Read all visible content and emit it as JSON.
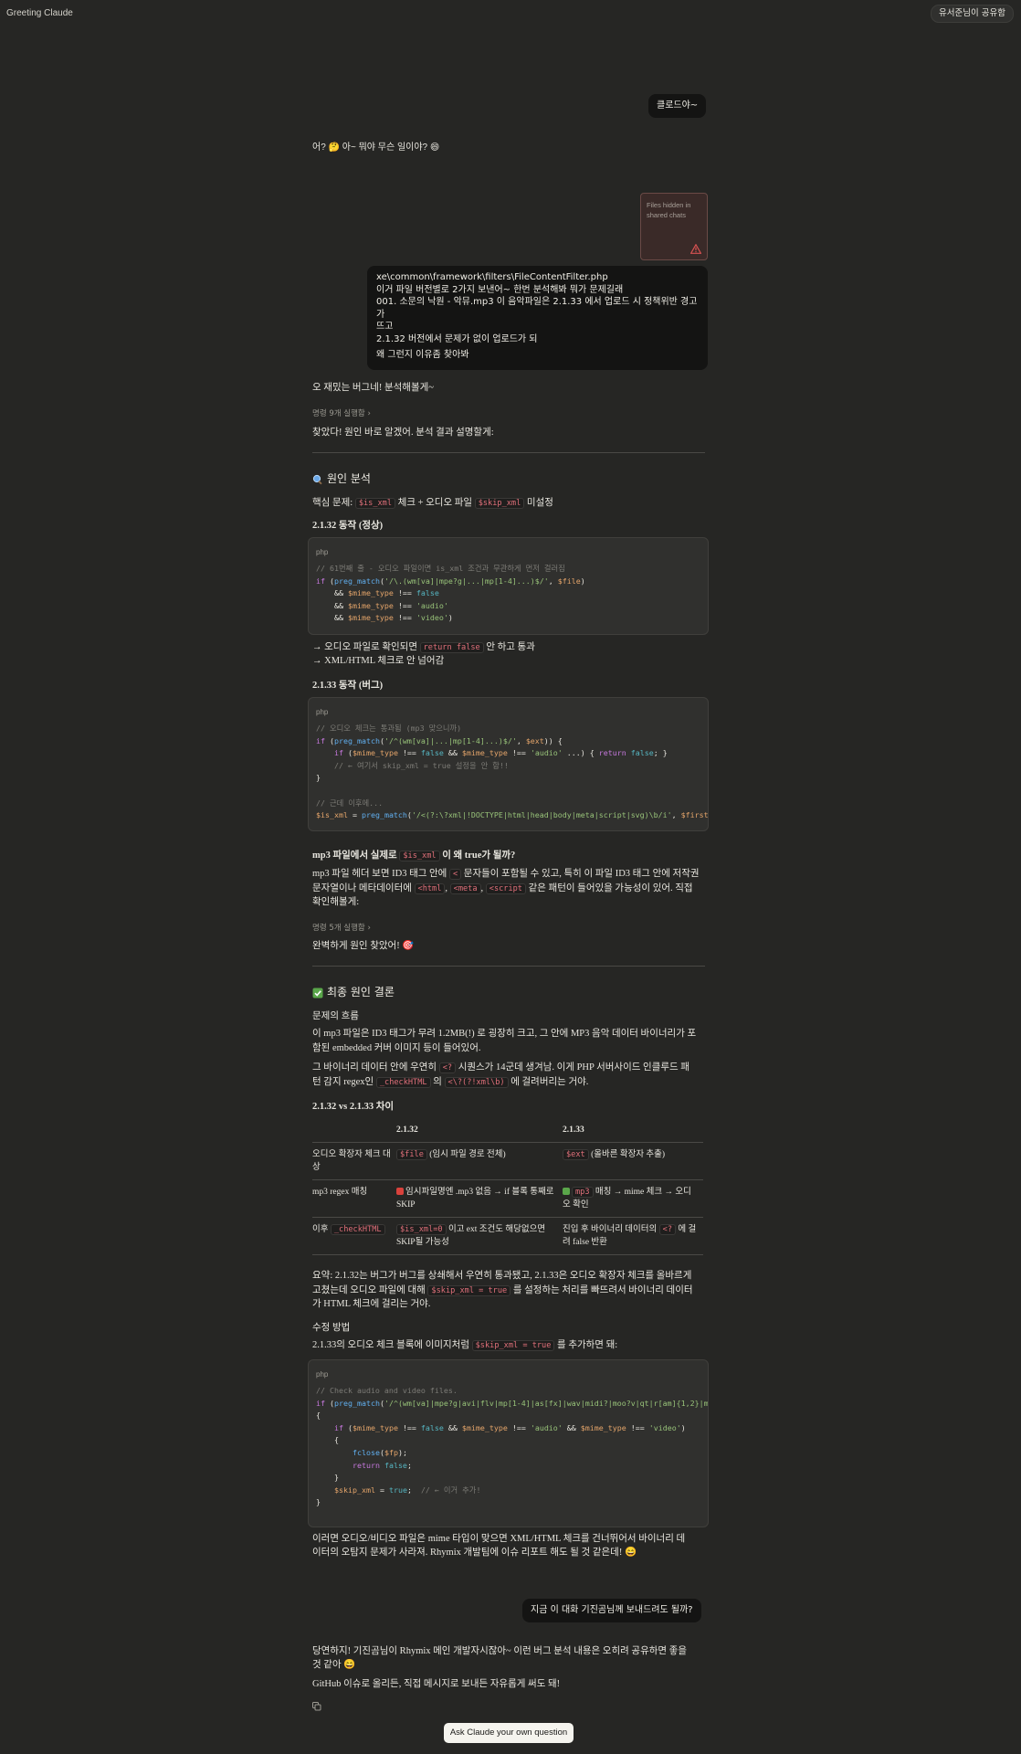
{
  "header": {
    "title": "Greeting Claude",
    "share_label": "유서준님이 공유함"
  },
  "conversation": {
    "user_msg_1": "클로드야~",
    "assistant_msg_1": "어? 🤔 아~ 뭐야 무슨 일이야? 😄",
    "attachment": {
      "line1": "Files hidden in",
      "line2": "shared chats"
    },
    "user_msg_2": {
      "lines": [
        "xe\\common\\framework\\filters\\FileContentFilter.php",
        "이거 파일 버전별로 2가지 보낸어~ 한번 분석해봐 뭐가 문제길래",
        "001. 소문의 낙원 - 악뮤.mp3 이 음악파일은 2.1.33 에서 업로드 시 정책위반 경고가",
        "뜨고",
        "2.1.32 버전에서 문제가 없이 업로드가 되",
        "왜 그런지 이유좀 찾아봐"
      ]
    },
    "assistant_msg_2": {
      "intro": "오 재밌는 버그네! 분석해볼게~",
      "steps_1": "명령 9개 실행함",
      "found": "찾았다! 원인 바로 알겠어. 분석 결과 설명할게:",
      "section_1_title": "원인 분석",
      "core_prefix": "핵심 문제: ",
      "core_code1": "$is_xml",
      "core_mid": " 체크 + 오디오 파일 ",
      "core_code2": "$skip_xml",
      "core_suffix": " 미설정",
      "v132_heading": "2.1.32 동작 (정상)",
      "code_lang": "php",
      "arrow1_pre": "→ 오디오 파일로 확인되면 ",
      "arrow1_code": "return false",
      "arrow1_post": " 안 하고 통과",
      "arrow2": "→ XML/HTML 체크로 안 넘어감",
      "v133_heading": "2.1.33 동작 (버그)",
      "why_q_pre": "mp3 파일에서 실제로 ",
      "why_q_code": "$is_xml",
      "why_q_post": " 이 왜 true가 될까?",
      "why_a1_pre": "mp3 파일 헤더 보면 ID3 태그 안에 ",
      "why_a1_code": "<",
      "why_a1_post": " 문자들이 포함될 수 있고, 특히 이 파일 ID3 태그 안에 저작권",
      "why_a2_pre": "문자열이나 메타데이터에 ",
      "why_a2_c1": "<html",
      "why_a2_c2": "<meta",
      "why_a2_c3": "<script",
      "why_a2_post": " 같은 패턴이 들어있을 가능성이 있어. 직접",
      "why_a3": "확인해볼게:",
      "steps_2": "명령 5개 실행함",
      "perfect": "완벽하게 원인 찾았어! 🎯",
      "section_2_title": "최종 원인 결론",
      "flow_label": "문제의 흐름",
      "flow_p1_a": "이 mp3 파일은 ID3 태그가 무려 1.2MB(!) 로 굉장히 크고, 그 안에 MP3 음악 데이터 바이너리가 포",
      "flow_p1_b": "함된 embedded 커버 이미지 등이 들어있어.",
      "flow_p2_a_pre": "그 바이너리 데이터 안에 우연히 ",
      "flow_p2_a_code": "<?",
      "flow_p2_a_post": " 시퀀스가 14군데 생겨남. 이게 PHP 서버사이드 인클루드 패",
      "flow_p2_b_pre": "턴 감지 regex인 ",
      "flow_p2_b_c1": "_checkHTML",
      "flow_p2_b_mid": " 의 ",
      "flow_p2_b_c2": "<\\?(?!xml\\b)",
      "flow_p2_b_post": " 에 걸려버리는 거야.",
      "table_heading": "2.1.32 vs 2.1.33 차이",
      "table": {
        "headers": [
          "",
          "2.1.32",
          "2.1.33"
        ],
        "rows": [
          {
            "label": "오디오 확장자 체크 대상",
            "c1_code": "$file",
            "c1_text": " (임시 파일 경로 전체)",
            "c2_code": "$ext",
            "c2_text": " (올바른 확장자 추출)"
          },
          {
            "label": "mp3 regex 매칭",
            "c1_text": "임시파일명엔 .mp3 없음 → if 블록 통째로 SKIP",
            "c2_code": "mp3",
            "c2_text": " 매칭 → mime 체크 → 오디오 확인"
          },
          {
            "label_pre": "이후 ",
            "label_code": "_checkHTML",
            "c1_code": "$is_xml=0",
            "c1_text": " 이고 ext 조건도 해당없으면 SKIP될 가능성",
            "c2_pre": "진입 후 바이너리 데이터의 ",
            "c2_code": "<?",
            "c2_text": " 에 걸려 false 반환"
          }
        ]
      },
      "summary_1": "요약: 2.1.32는 버그가 버그를 상쇄해서 우연히 통과됐고, 2.1.33은 오디오 확장자 체크를 올바르게",
      "summary_2_pre": "고쳤는데 오디오 파일에 대해 ",
      "summary_2_code": "$skip_xml = true",
      "summary_2_post": " 를 설정하는 처리를 빠뜨려서 바이너리 데이터",
      "summary_3": "가 HTML 체크에 걸리는 거야.",
      "fix_heading": "수정 방법",
      "fix_line_pre": "2.1.33의 오디오 체크 블록에 이미지처럼 ",
      "fix_line_code": "$skip_xml = true",
      "fix_line_post": " 를 추가하면 돼:",
      "closing_1": "이러면 오디오/비디오 파일은 mime 타입이 맞으면 XML/HTML 체크를 건너뛰어서 바이너리 데",
      "closing_2": "이터의 오탐지 문제가 사라져. Rhymix 개발팀에 이슈 리포트 해도 될 것 같은데! 😄"
    },
    "user_msg_3": "지금 이 대화 기진곰님께 보내드려도 될까?",
    "assistant_msg_3": {
      "line1": "당연하지! 기진곰님이 Rhymix 메인 개발자시잖아~ 이런 버그 분석 내용은 오히려 공유하면 좋을",
      "line2": "것 같아 😄",
      "line3": "GitHub 이슈로 올리든, 직접 메시지로 보내든 자유롭게 써도 돼!"
    }
  },
  "footer": {
    "cta": "Ask Claude your own question"
  },
  "colors": {
    "background": "#262624",
    "user_bubble": "#141413",
    "code_bg": "#30302e",
    "inline_code": "#e0707a"
  }
}
